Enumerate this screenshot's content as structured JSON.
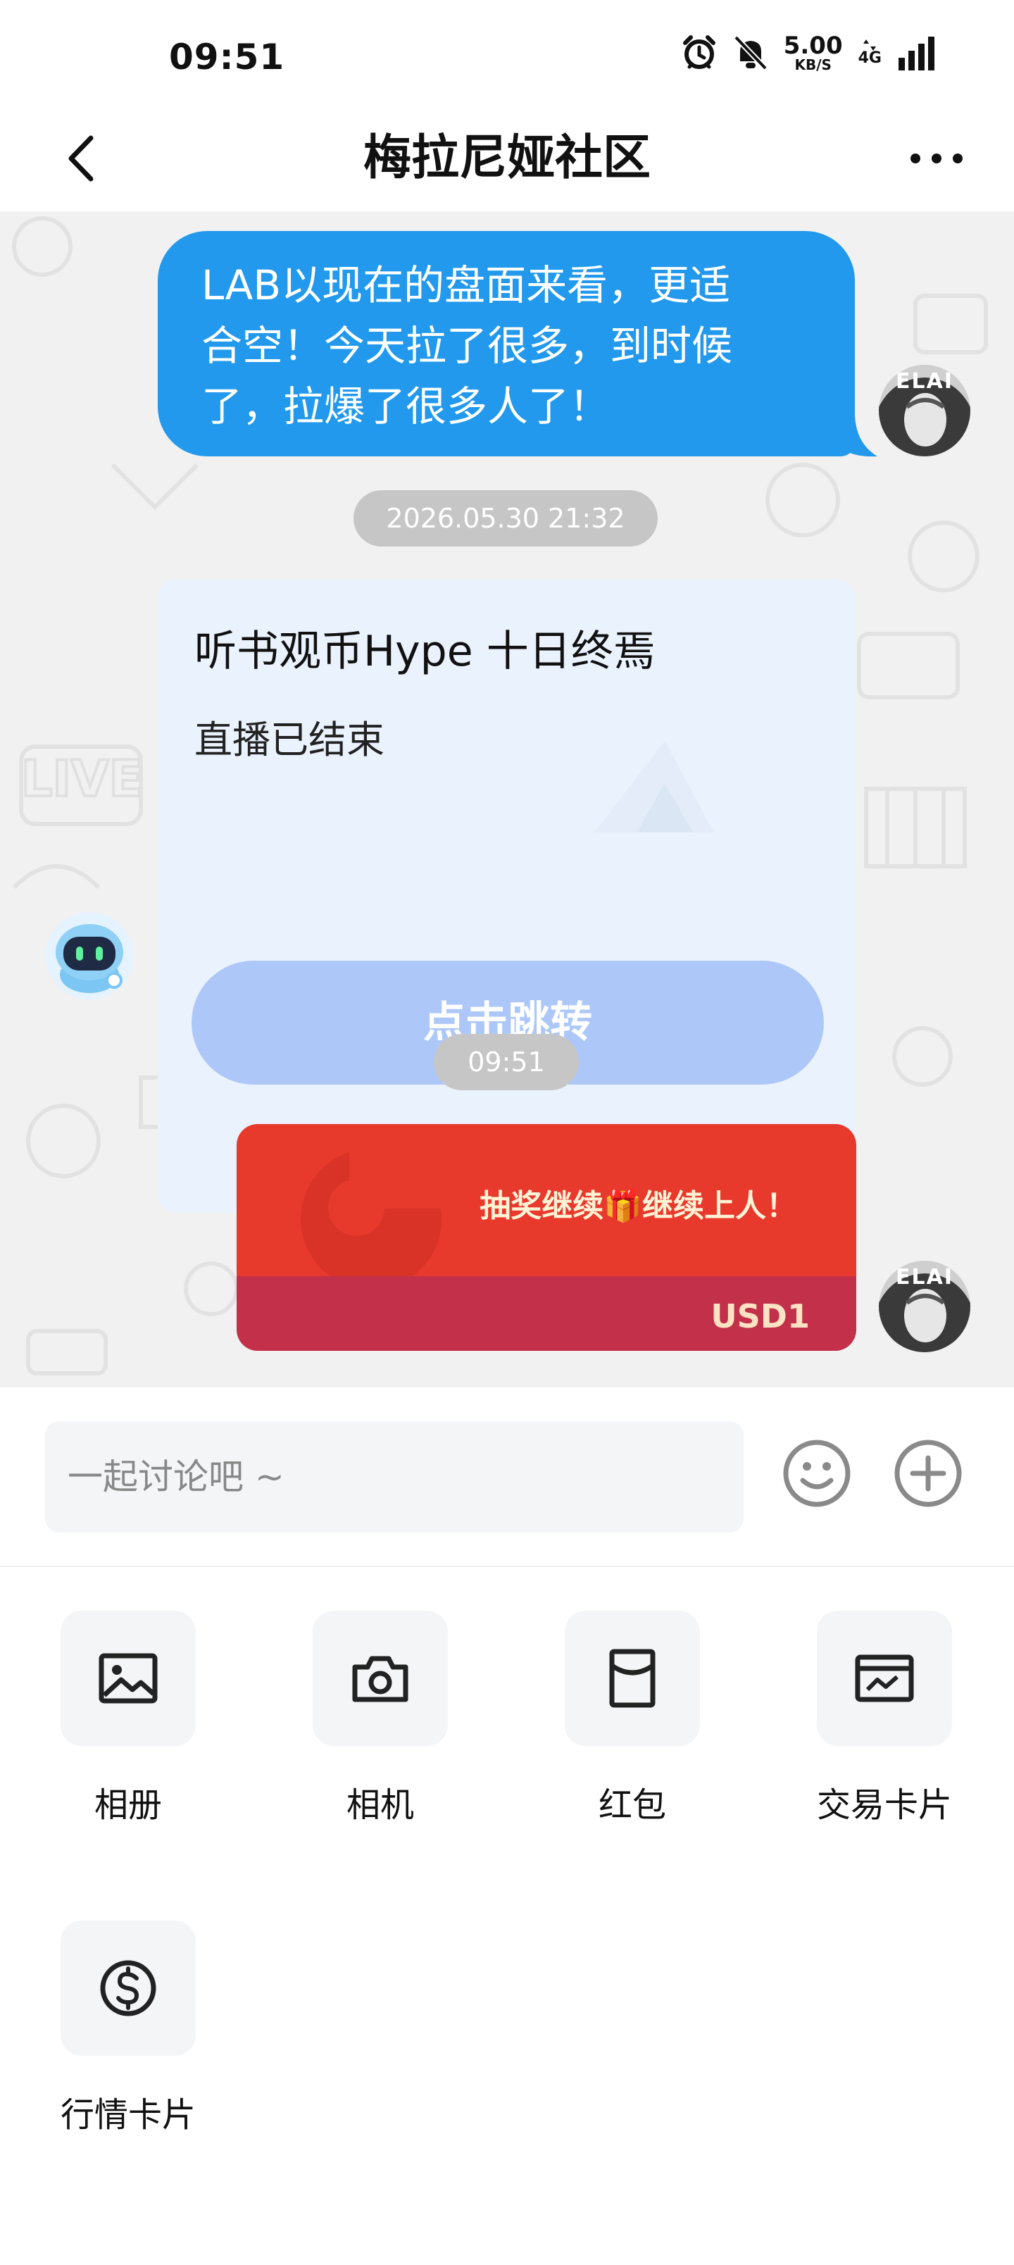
{
  "status_bar": {
    "time": "09:51",
    "net_speed": "5.00",
    "net_unit": "KB/S",
    "net_type": "4G"
  },
  "header": {
    "title": "梅拉尼娅社区",
    "back_icon": "chevron-left-icon",
    "more_icon": "more-horizontal-icon"
  },
  "chat": {
    "messages": [
      {
        "type": "text",
        "sender": "self",
        "lines": [
          "LAB以现在的盘面来看，更适",
          "合空！今天拉了很多，到时候",
          "了，拉爆了很多人了！"
        ],
        "avatar_text": "ELAI"
      },
      {
        "type": "timestamp",
        "text": "2026.05.30 21:32"
      },
      {
        "type": "live_card",
        "sender": "bot",
        "title": "听书观币Hype 十日终焉",
        "status": "直播已结束",
        "button_label": "点击跳转"
      },
      {
        "type": "timestamp",
        "text": "09:51"
      },
      {
        "type": "red_packet",
        "sender": "self",
        "message": "抽奖继续🎁继续上人！",
        "amount": "USD1",
        "avatar_text": "ELAI"
      }
    ]
  },
  "input_bar": {
    "placeholder": "一起讨论吧 ~",
    "emoji_icon": "smiley-icon",
    "plus_icon": "plus-circle-icon"
  },
  "actions": [
    {
      "label": "相册",
      "icon": "image-icon"
    },
    {
      "label": "相机",
      "icon": "camera-icon"
    },
    {
      "label": "红包",
      "icon": "red-envelope-icon"
    },
    {
      "label": "交易卡片",
      "icon": "trade-card-icon"
    },
    {
      "label": "行情卡片",
      "icon": "dollar-circle-icon"
    }
  ],
  "colors": {
    "bubble_blue": "#2299ec",
    "card_bg": "#eaf2fd",
    "jump_button": "#adc8f8",
    "red_packet_top": "#e8392d",
    "red_packet_bottom": "#c2304a",
    "chat_bg": "#f1f1f1"
  }
}
